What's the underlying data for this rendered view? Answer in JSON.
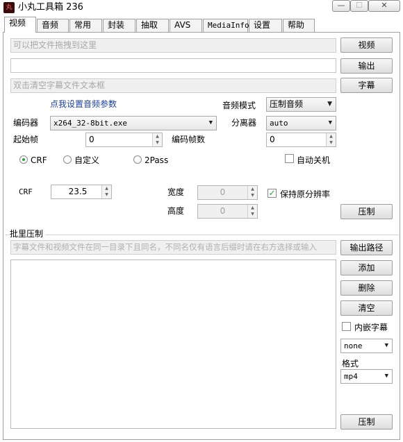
{
  "window": {
    "icon_text": "丸",
    "title": "小丸工具箱 236",
    "controls": {
      "minimize": "—",
      "maximize": "☐",
      "close": "✕"
    }
  },
  "tabs": [
    {
      "label": "视频",
      "active": true
    },
    {
      "label": "音频"
    },
    {
      "label": "常用"
    },
    {
      "label": "封装"
    },
    {
      "label": "抽取"
    },
    {
      "label": "AVS"
    },
    {
      "label": "MediaInfo"
    },
    {
      "label": "设置"
    },
    {
      "label": "帮助"
    }
  ],
  "video": {
    "input_placeholder": "可以把文件拖拽到这里",
    "output_value": "",
    "subtitle_placeholder": "双击清空字幕文件文本框",
    "buttons": {
      "video": "视频",
      "output": "输出",
      "subtitle": "字幕",
      "encode": "压制"
    },
    "audio_params_link": "点我设置音频参数",
    "audio_mode_label": "音频模式",
    "audio_mode_value": "压制音频",
    "encoder_label": "编码器",
    "encoder_value": "x264_32-8bit.exe",
    "demuxer_label": "分离器",
    "demuxer_value": "auto",
    "start_frame_label": "起始帧",
    "start_frame_value": "0",
    "encode_frames_label": "编码帧数",
    "encode_frames_value": "0",
    "mode_options": [
      "CRF",
      "自定义",
      "2Pass"
    ],
    "mode_selected": "CRF",
    "auto_shutdown_label": "自动关机",
    "auto_shutdown_checked": false,
    "crf_label": "CRF",
    "crf_value": "23.5",
    "width_label": "宽度",
    "width_value": "0",
    "height_label": "高度",
    "height_value": "0",
    "keep_resolution_label": "保持原分辨率",
    "keep_resolution_checked": true
  },
  "batch": {
    "group_label": "批里压制",
    "hint": "字幕文件和视频文件在同一目录下且同名，不同名仅有语言后缀时请在右方选择或输入",
    "buttons": {
      "output_path": "输出路径",
      "add": "添加",
      "delete": "删除",
      "clear": "清空",
      "encode": "压制"
    },
    "embed_subtitle_label": "内嵌字幕",
    "embed_subtitle_checked": false,
    "subtitle_lang_value": "none",
    "format_label": "格式",
    "format_value": "mp4",
    "files": []
  },
  "colors": {
    "accent_link": "#1a3fa0",
    "check_green": "#2aa63a"
  }
}
